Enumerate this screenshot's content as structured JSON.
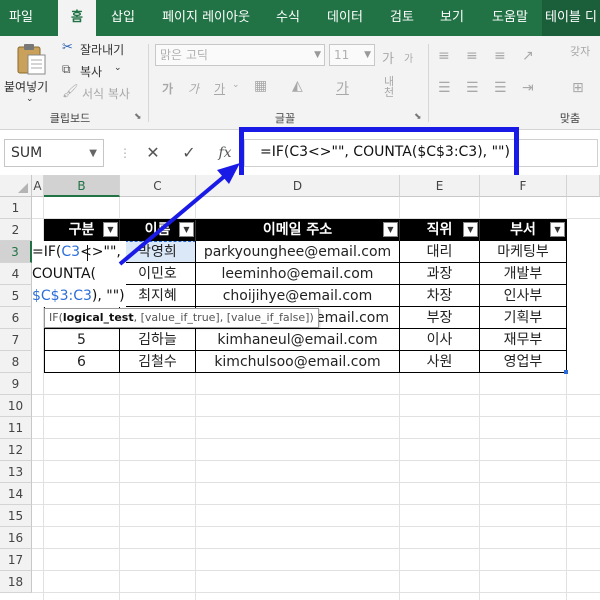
{
  "ribbon_tabs": [
    {
      "label": "파일",
      "active": false
    },
    {
      "label": "홈",
      "active": true
    },
    {
      "label": "삽입",
      "active": false
    },
    {
      "label": "페이지 레이아웃",
      "active": false
    },
    {
      "label": "수식",
      "active": false
    },
    {
      "label": "데이터",
      "active": false
    },
    {
      "label": "검토",
      "active": false
    },
    {
      "label": "보기",
      "active": false
    },
    {
      "label": "도움말",
      "active": false
    },
    {
      "label": "테이블 디",
      "active": false
    }
  ],
  "clipboard": {
    "paste_label": "붙여넣기",
    "cut_label": "잘라내기",
    "copy_label": "복사",
    "format_painter_label": "서식 복사",
    "group_label": "클립보드"
  },
  "font": {
    "font_name": "맑은 고딕",
    "font_size": "11",
    "bold": "가",
    "italic": "가",
    "underline": "가",
    "grow": "가",
    "shrink": "가",
    "hangul_convert": "내천",
    "group_label": "글꼴"
  },
  "alignment": {
    "group_label": "맞춤",
    "wrap_label": "갖자"
  },
  "name_box": "SUM",
  "formula_bar": {
    "cancel_icon": "✕",
    "enter_icon": "✓",
    "fx_icon": "fx",
    "formula": "=IF(C3<>\"\", COUNTA($C$3:C3), \"\")"
  },
  "columns": [
    "A",
    "B",
    "C",
    "D",
    "E",
    "F"
  ],
  "rows": [
    "1",
    "2",
    "3",
    "4",
    "5",
    "6",
    "7",
    "8",
    "9",
    "10",
    "11",
    "12",
    "13",
    "14",
    "15",
    "16",
    "17",
    "18"
  ],
  "table": {
    "headers": [
      "구분",
      "이름",
      "이메일 주소",
      "직위",
      "부서"
    ],
    "rows": [
      [
        "",
        "박영희",
        "parkyounghee@email.com",
        "대리",
        "마케팅부"
      ],
      [
        "",
        "이민호",
        "leeminho@email.com",
        "과장",
        "개발부"
      ],
      [
        "",
        "최지혜",
        "choijihye@email.com",
        "차장",
        "인사부"
      ],
      [
        "",
        "",
        "@email.com",
        "부장",
        "기획부"
      ],
      [
        "5",
        "김하늘",
        "kimhaneul@email.com",
        "이사",
        "재무부"
      ],
      [
        "6",
        "김철수",
        "kimchulsoo@email.com",
        "사원",
        "영업부"
      ]
    ]
  },
  "editing": {
    "line1_prefix": "=IF(",
    "line1_ref": "C3",
    "line1_suffix": "<>\"\",",
    "line2": "COUNTA(",
    "line3_ref": "$C$3:C3",
    "line3_suffix": "), \"\")"
  },
  "tooltip": {
    "func": "IF(",
    "arg1": "logical_test",
    "rest": ", [value_if_true], [value_if_false])"
  },
  "colors": {
    "ribbon": "#217346",
    "callout": "#1a1ae6",
    "reference": "#2b6ed8"
  }
}
